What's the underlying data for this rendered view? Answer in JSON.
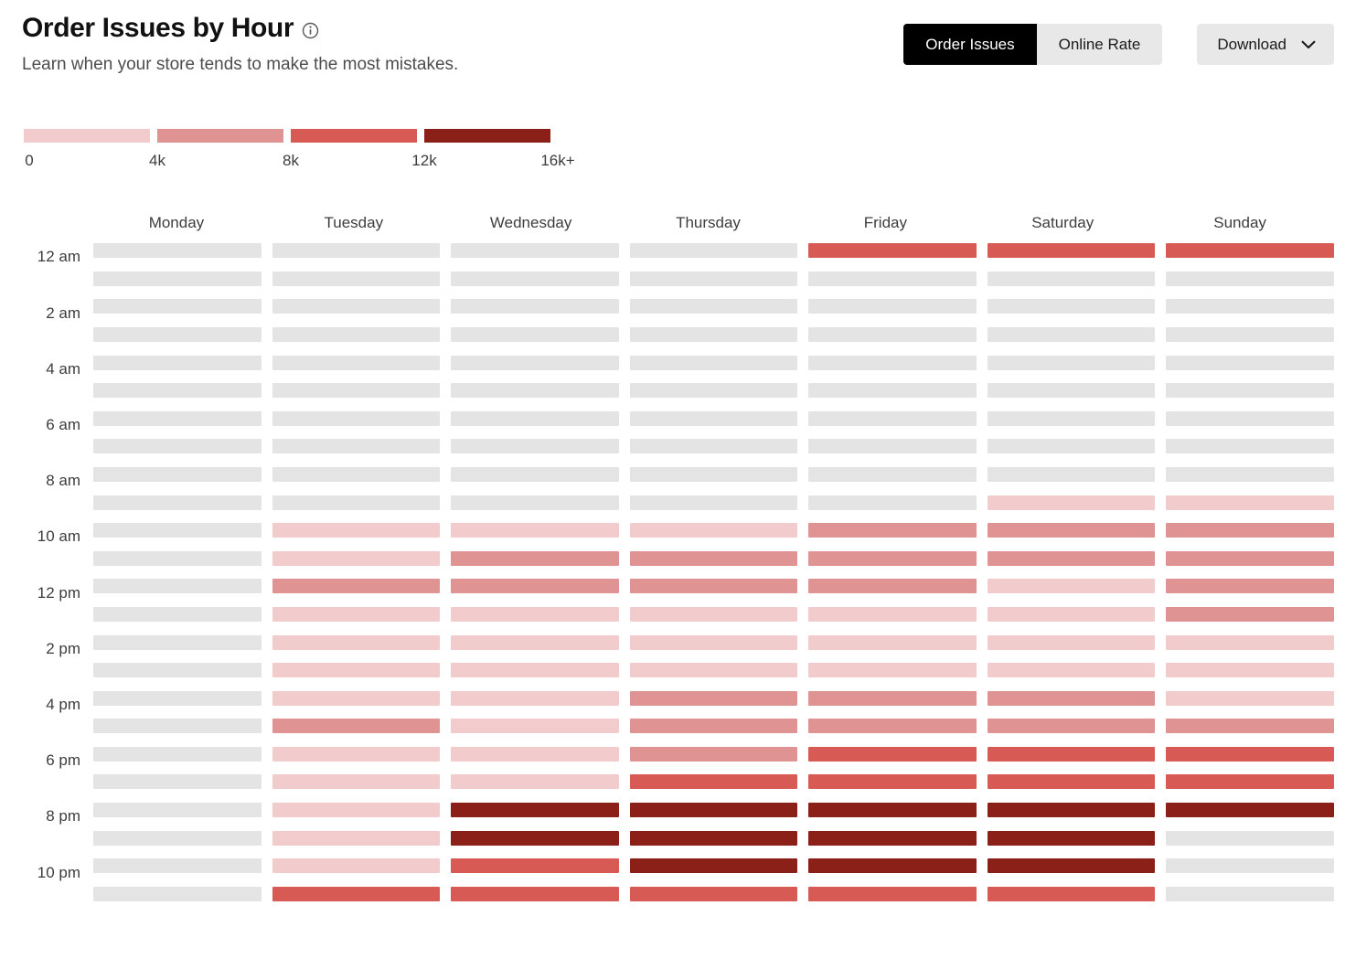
{
  "header": {
    "title": "Order Issues by Hour",
    "info_icon": "info-circle-icon",
    "subtitle": "Learn when your store tends to make the most mistakes.",
    "toggle": [
      {
        "label": "Order Issues",
        "active": true
      },
      {
        "label": "Online Rate",
        "active": false
      }
    ],
    "download": {
      "label": "Download",
      "icon": "chevron-down-icon"
    }
  },
  "legend": {
    "swatch_colors": [
      "#F2CCCC",
      "#E09393",
      "#D85A55",
      "#8B2018"
    ],
    "tick_labels": [
      "0",
      "4k",
      "8k",
      "12k",
      "16k+"
    ]
  },
  "colors": {
    "empty": "#E4E4E4",
    "level1": "#F2CCCC",
    "level2": "#E09393",
    "level3": "#D85A55",
    "level4": "#8B2018",
    "accent_active_bg": "#000000",
    "control_bg": "#E8E8E8",
    "text_primary": "#111111",
    "text_secondary": "#4D4D4D"
  },
  "chart_data": {
    "type": "heatmap",
    "title": "Order Issues by Hour",
    "subtitle": "Learn when your store tends to make the most mistakes.",
    "xlabel": "",
    "ylabel": "",
    "metric": "Order Issues",
    "legend_position": "top-left",
    "grid": false,
    "color_scale": {
      "levels": [
        0,
        1,
        2,
        3,
        4
      ],
      "colors": [
        "#E4E4E4",
        "#F2CCCC",
        "#E09393",
        "#D85A55",
        "#8B2018"
      ],
      "bin_edges": [
        0,
        4000,
        8000,
        12000,
        16000
      ],
      "tick_labels": [
        "0",
        "4k",
        "8k",
        "12k",
        "16k+"
      ]
    },
    "categories": [
      "Monday",
      "Tuesday",
      "Wednesday",
      "Thursday",
      "Friday",
      "Saturday",
      "Sunday"
    ],
    "y": [
      "12 am",
      "1 am",
      "2 am",
      "3 am",
      "4 am",
      "5 am",
      "6 am",
      "7 am",
      "8 am",
      "9 am",
      "10 am",
      "11 am",
      "12 pm",
      "1 pm",
      "2 pm",
      "3 pm",
      "4 pm",
      "5 pm",
      "6 pm",
      "7 pm",
      "8 pm",
      "9 pm",
      "10 pm",
      "11 pm"
    ],
    "y_tick_labels": [
      "12 am",
      "2 am",
      "4 am",
      "6 am",
      "8 am",
      "10 am",
      "12 pm",
      "2 pm",
      "4 pm",
      "6 pm",
      "8 pm",
      "10 pm"
    ],
    "values": [
      [
        0,
        0,
        0,
        0,
        3,
        3,
        3
      ],
      [
        0,
        0,
        0,
        0,
        0,
        0,
        0
      ],
      [
        0,
        0,
        0,
        0,
        0,
        0,
        0
      ],
      [
        0,
        0,
        0,
        0,
        0,
        0,
        0
      ],
      [
        0,
        0,
        0,
        0,
        0,
        0,
        0
      ],
      [
        0,
        0,
        0,
        0,
        0,
        0,
        0
      ],
      [
        0,
        0,
        0,
        0,
        0,
        0,
        0
      ],
      [
        0,
        0,
        0,
        0,
        0,
        0,
        0
      ],
      [
        0,
        0,
        0,
        0,
        0,
        0,
        0
      ],
      [
        0,
        0,
        0,
        0,
        0,
        1,
        1
      ],
      [
        0,
        1,
        1,
        1,
        2,
        2,
        2
      ],
      [
        0,
        1,
        2,
        2,
        2,
        2,
        2
      ],
      [
        0,
        2,
        2,
        2,
        2,
        1,
        2
      ],
      [
        0,
        1,
        1,
        1,
        1,
        1,
        2
      ],
      [
        0,
        1,
        1,
        1,
        1,
        1,
        1
      ],
      [
        0,
        1,
        1,
        1,
        1,
        1,
        1
      ],
      [
        0,
        1,
        1,
        2,
        2,
        2,
        1
      ],
      [
        0,
        2,
        1,
        2,
        2,
        2,
        2
      ],
      [
        0,
        1,
        1,
        2,
        3,
        3,
        3
      ],
      [
        0,
        1,
        1,
        3,
        3,
        3,
        3
      ],
      [
        0,
        1,
        4,
        4,
        4,
        4,
        4
      ],
      [
        0,
        1,
        4,
        4,
        4,
        4,
        0
      ],
      [
        0,
        1,
        3,
        4,
        4,
        4,
        0
      ],
      [
        0,
        3,
        3,
        3,
        3,
        3,
        0
      ]
    ]
  }
}
